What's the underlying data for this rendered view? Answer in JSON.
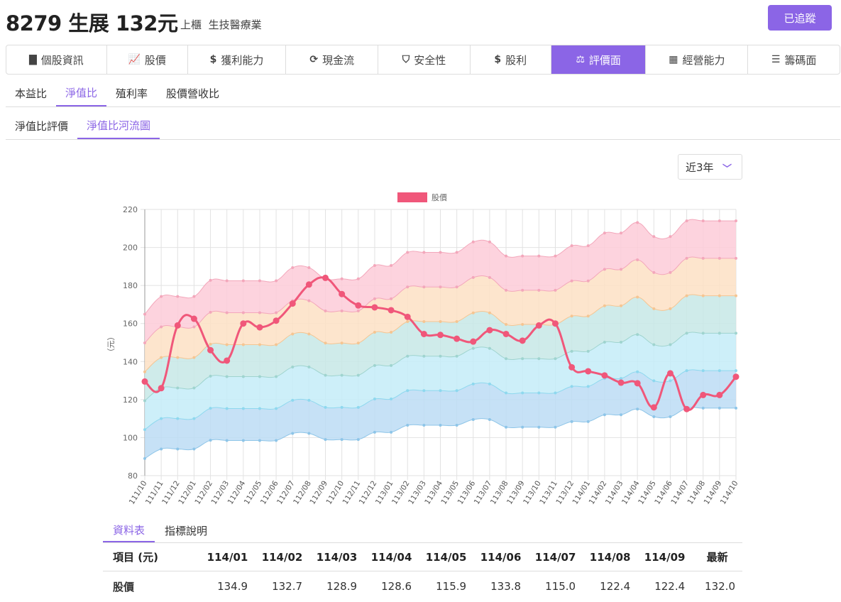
{
  "header": {
    "title": "8279 生展 132元",
    "market": "上櫃",
    "industry": "生技醫療業",
    "follow_label": "已追蹤"
  },
  "nav": [
    {
      "icon": "file-icon",
      "glyph": "▇",
      "label": "個股資訊"
    },
    {
      "icon": "line-chart-icon",
      "glyph": "📈",
      "label": "股價"
    },
    {
      "icon": "dollar-icon",
      "glyph": "$",
      "label": "獲利能力"
    },
    {
      "icon": "refresh-icon",
      "glyph": "⟳",
      "label": "現金流"
    },
    {
      "icon": "shield-icon",
      "glyph": "⛉",
      "label": "安全性"
    },
    {
      "icon": "money-bag-icon",
      "glyph": "$",
      "label": "股利"
    },
    {
      "icon": "balance-scale-icon",
      "glyph": "⚖",
      "label": "評價面"
    },
    {
      "icon": "building-icon",
      "glyph": "▦",
      "label": "經營能力"
    },
    {
      "icon": "database-icon",
      "glyph": "☰",
      "label": "籌碼面"
    }
  ],
  "subtabs": [
    "本益比",
    "淨值比",
    "殖利率",
    "股價營收比"
  ],
  "subtabs2": [
    "淨值比評價",
    "淨值比河流圖"
  ],
  "range": {
    "selected": "近3年"
  },
  "chart_data": {
    "type": "area",
    "legend": [
      "股價"
    ],
    "ylabel": "（元）",
    "ylim": [
      80,
      220
    ],
    "yticks": [
      80,
      100,
      120,
      140,
      160,
      180,
      200,
      220
    ],
    "x": [
      "111/10",
      "111/11",
      "111/12",
      "112/01",
      "112/02",
      "112/03",
      "112/04",
      "112/05",
      "112/06",
      "112/07",
      "112/08",
      "112/09",
      "112/10",
      "112/11",
      "112/12",
      "113/01",
      "113/02",
      "113/03",
      "113/04",
      "113/05",
      "113/06",
      "113/07",
      "113/08",
      "113/09",
      "113/10",
      "113/11",
      "113/12",
      "114/01",
      "114/02",
      "114/03",
      "114/04",
      "114/05",
      "114/06",
      "114/07",
      "114/08",
      "114/09",
      "114/10"
    ],
    "price": [
      129.5,
      126,
      159,
      162.5,
      146,
      140.5,
      160,
      158,
      161.5,
      170.5,
      180.5,
      184,
      175.5,
      169.5,
      168.5,
      167,
      163.5,
      154.5,
      154,
      152,
      150.5,
      156.5,
      154.5,
      151,
      159,
      160,
      137,
      134.9,
      132.7,
      128.9,
      128.6,
      115.9,
      133.8,
      115.0,
      122.4,
      122.4,
      132.0
    ],
    "bands": [
      [
        89,
        104.2,
        119.4,
        134.6,
        149.8,
        164.9
      ],
      [
        94,
        110,
        126.1,
        142.1,
        158.2,
        174.2
      ],
      [
        94,
        110,
        126.1,
        142.1,
        158.2,
        174.2
      ],
      [
        94,
        110,
        126.1,
        142.1,
        158.2,
        174.2
      ],
      [
        98.6,
        115.4,
        132.3,
        149.1,
        165.9,
        182.7
      ],
      [
        98.5,
        115.3,
        132.1,
        148.9,
        165.7,
        182.5
      ],
      [
        98.5,
        115.3,
        132.1,
        148.9,
        165.7,
        182.5
      ],
      [
        98.5,
        115.3,
        132.1,
        148.9,
        165.7,
        182.5
      ],
      [
        98.5,
        115.3,
        132.1,
        148.9,
        165.7,
        182.5
      ],
      [
        102.2,
        119.6,
        137.1,
        154.5,
        172,
        189.4
      ],
      [
        102.2,
        119.6,
        137.1,
        154.5,
        172,
        189.4
      ],
      [
        99,
        115.9,
        132.8,
        149.7,
        166.6,
        183.5
      ],
      [
        99,
        115.9,
        132.8,
        149.7,
        166.6,
        183.5
      ],
      [
        99,
        115.9,
        132.8,
        149.7,
        166.6,
        183.5
      ],
      [
        102.8,
        120.3,
        137.9,
        155.4,
        173,
        190.5
      ],
      [
        102.8,
        120.3,
        137.9,
        155.4,
        173,
        190.5
      ],
      [
        106.5,
        124.7,
        142.8,
        161,
        179.2,
        197.4
      ],
      [
        106.5,
        124.7,
        142.8,
        161,
        179.2,
        197.4
      ],
      [
        106.5,
        124.7,
        142.8,
        161,
        179.2,
        197.4
      ],
      [
        106.5,
        124.7,
        142.8,
        161,
        179.2,
        197.4
      ],
      [
        109.5,
        128.2,
        146.9,
        165.6,
        184.2,
        202.9
      ],
      [
        109.5,
        128.2,
        146.9,
        165.6,
        184.2,
        202.9
      ],
      [
        105.5,
        123.5,
        141.5,
        159.5,
        177.5,
        195.5
      ],
      [
        105.5,
        123.5,
        141.5,
        159.5,
        177.5,
        195.5
      ],
      [
        105.5,
        123.5,
        141.5,
        159.5,
        177.5,
        195.5
      ],
      [
        105.5,
        123.5,
        141.5,
        159.5,
        177.5,
        195.5
      ],
      [
        108.4,
        126.9,
        145.4,
        163.9,
        182.4,
        200.9
      ],
      [
        108.4,
        126.9,
        145.4,
        163.9,
        182.4,
        200.9
      ],
      [
        112,
        131.1,
        150.2,
        169.3,
        188.5,
        207.6
      ],
      [
        112,
        131.1,
        150.2,
        169.3,
        188.5,
        207.6
      ],
      [
        115,
        134.6,
        154.2,
        173.9,
        193.5,
        213.1
      ],
      [
        111,
        129.9,
        148.9,
        167.8,
        186.8,
        205.7
      ],
      [
        111,
        129.9,
        148.9,
        167.8,
        186.8,
        205.7
      ],
      [
        115.5,
        135.2,
        154.9,
        174.6,
        194.3,
        214
      ],
      [
        115.5,
        135.2,
        154.9,
        174.6,
        194.3,
        214
      ],
      [
        115.5,
        135.2,
        154.9,
        174.6,
        194.3,
        214
      ],
      [
        115.5,
        135.2,
        154.9,
        174.6,
        194.3,
        214
      ]
    ],
    "band_colors": [
      "#bcdcf5",
      "#c4ecf8",
      "#c7e8e6",
      "#fde0c4",
      "#fdcbd8"
    ],
    "band_line_colors": [
      "#8ec5e8",
      "#8ed8ee",
      "#9fd4cf",
      "#f5c592",
      "#f3a7bb"
    ],
    "price_color": "#f0577a"
  },
  "table_tabs": [
    "資料表",
    "指標說明"
  ],
  "table": {
    "header": [
      "項目 (元)",
      "114/01",
      "114/02",
      "114/03",
      "114/04",
      "114/05",
      "114/06",
      "114/07",
      "114/08",
      "114/09",
      "最新"
    ],
    "rows": [
      [
        "股價",
        "134.9",
        "132.7",
        "128.9",
        "128.6",
        "115.9",
        "133.8",
        "115.0",
        "122.4",
        "122.4",
        "132.0"
      ]
    ]
  }
}
